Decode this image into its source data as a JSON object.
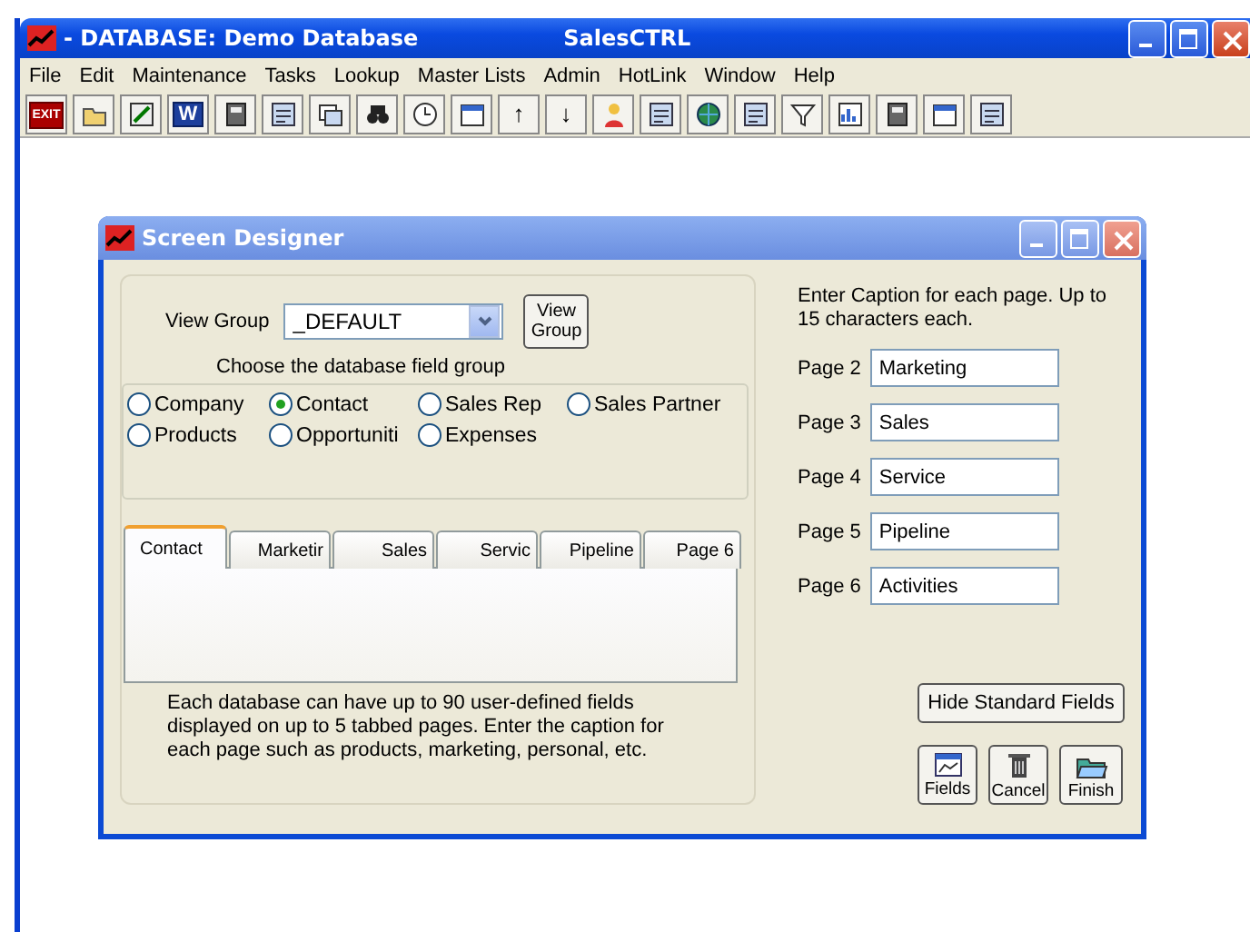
{
  "window": {
    "title": "- DATABASE:  Demo Database",
    "app_name": "SalesCTRL"
  },
  "menu": [
    "File",
    "Edit",
    "Maintenance",
    "Tasks",
    "Lookup",
    "Master Lists",
    "Admin",
    "HotLink",
    "Window",
    "Help"
  ],
  "toolbar": [
    {
      "kind": "exit",
      "label": "EXIT"
    },
    {
      "kind": "folder"
    },
    {
      "kind": "note"
    },
    {
      "kind": "word",
      "label": "W"
    },
    {
      "kind": "book"
    },
    {
      "kind": "form"
    },
    {
      "kind": "windows"
    },
    {
      "kind": "binoculars"
    },
    {
      "kind": "clock"
    },
    {
      "kind": "calendar"
    },
    {
      "kind": "arrow",
      "label": "↑"
    },
    {
      "kind": "arrow",
      "label": "↓"
    },
    {
      "kind": "person"
    },
    {
      "kind": "form"
    },
    {
      "kind": "globe"
    },
    {
      "kind": "form"
    },
    {
      "kind": "filter"
    },
    {
      "kind": "chart"
    },
    {
      "kind": "book"
    },
    {
      "kind": "calendar"
    },
    {
      "kind": "form"
    }
  ],
  "dialog": {
    "title": "Screen Designer",
    "view_group": {
      "label": "View Group",
      "value": "_DEFAULT",
      "button": "View Group"
    },
    "group_hint": "Choose the database field group",
    "groups": [
      {
        "label": "Company",
        "selected": false
      },
      {
        "label": "Contact",
        "selected": true
      },
      {
        "label": "Sales Rep",
        "selected": false
      },
      {
        "label": "Sales Partner",
        "selected": false
      },
      {
        "label": "Products",
        "selected": false
      },
      {
        "label": "Opportuniti",
        "selected": false
      },
      {
        "label": "Expenses",
        "selected": false
      }
    ],
    "tabs": [
      {
        "label": "Contact",
        "selected": true
      },
      {
        "label": "Marketir",
        "selected": false
      },
      {
        "label": "Sales",
        "selected": false
      },
      {
        "label": "Servic",
        "selected": false
      },
      {
        "label": "Pipeline",
        "selected": false
      },
      {
        "label": "Page 6",
        "selected": false
      }
    ],
    "description": "Each database can have up to 90 user-defined fields displayed on up to 5 tabbed pages.  Enter the caption for each page such as products, marketing, personal, etc.",
    "caption_hint": "Enter Caption for each page. Up to 15 characters each.",
    "pages": [
      {
        "label": "Page 2",
        "value": "Marketing"
      },
      {
        "label": "Page 3",
        "value": "Sales"
      },
      {
        "label": "Page 4",
        "value": "Service"
      },
      {
        "label": "Page 5",
        "value": "Pipeline"
      },
      {
        "label": "Page 6",
        "value": "Activities"
      }
    ],
    "hide_button": "Hide Standard Fields",
    "actions": [
      {
        "kind": "fields",
        "label": "Fields"
      },
      {
        "kind": "cancel",
        "label": "Cancel"
      },
      {
        "kind": "finish",
        "label": "Finish"
      }
    ]
  }
}
